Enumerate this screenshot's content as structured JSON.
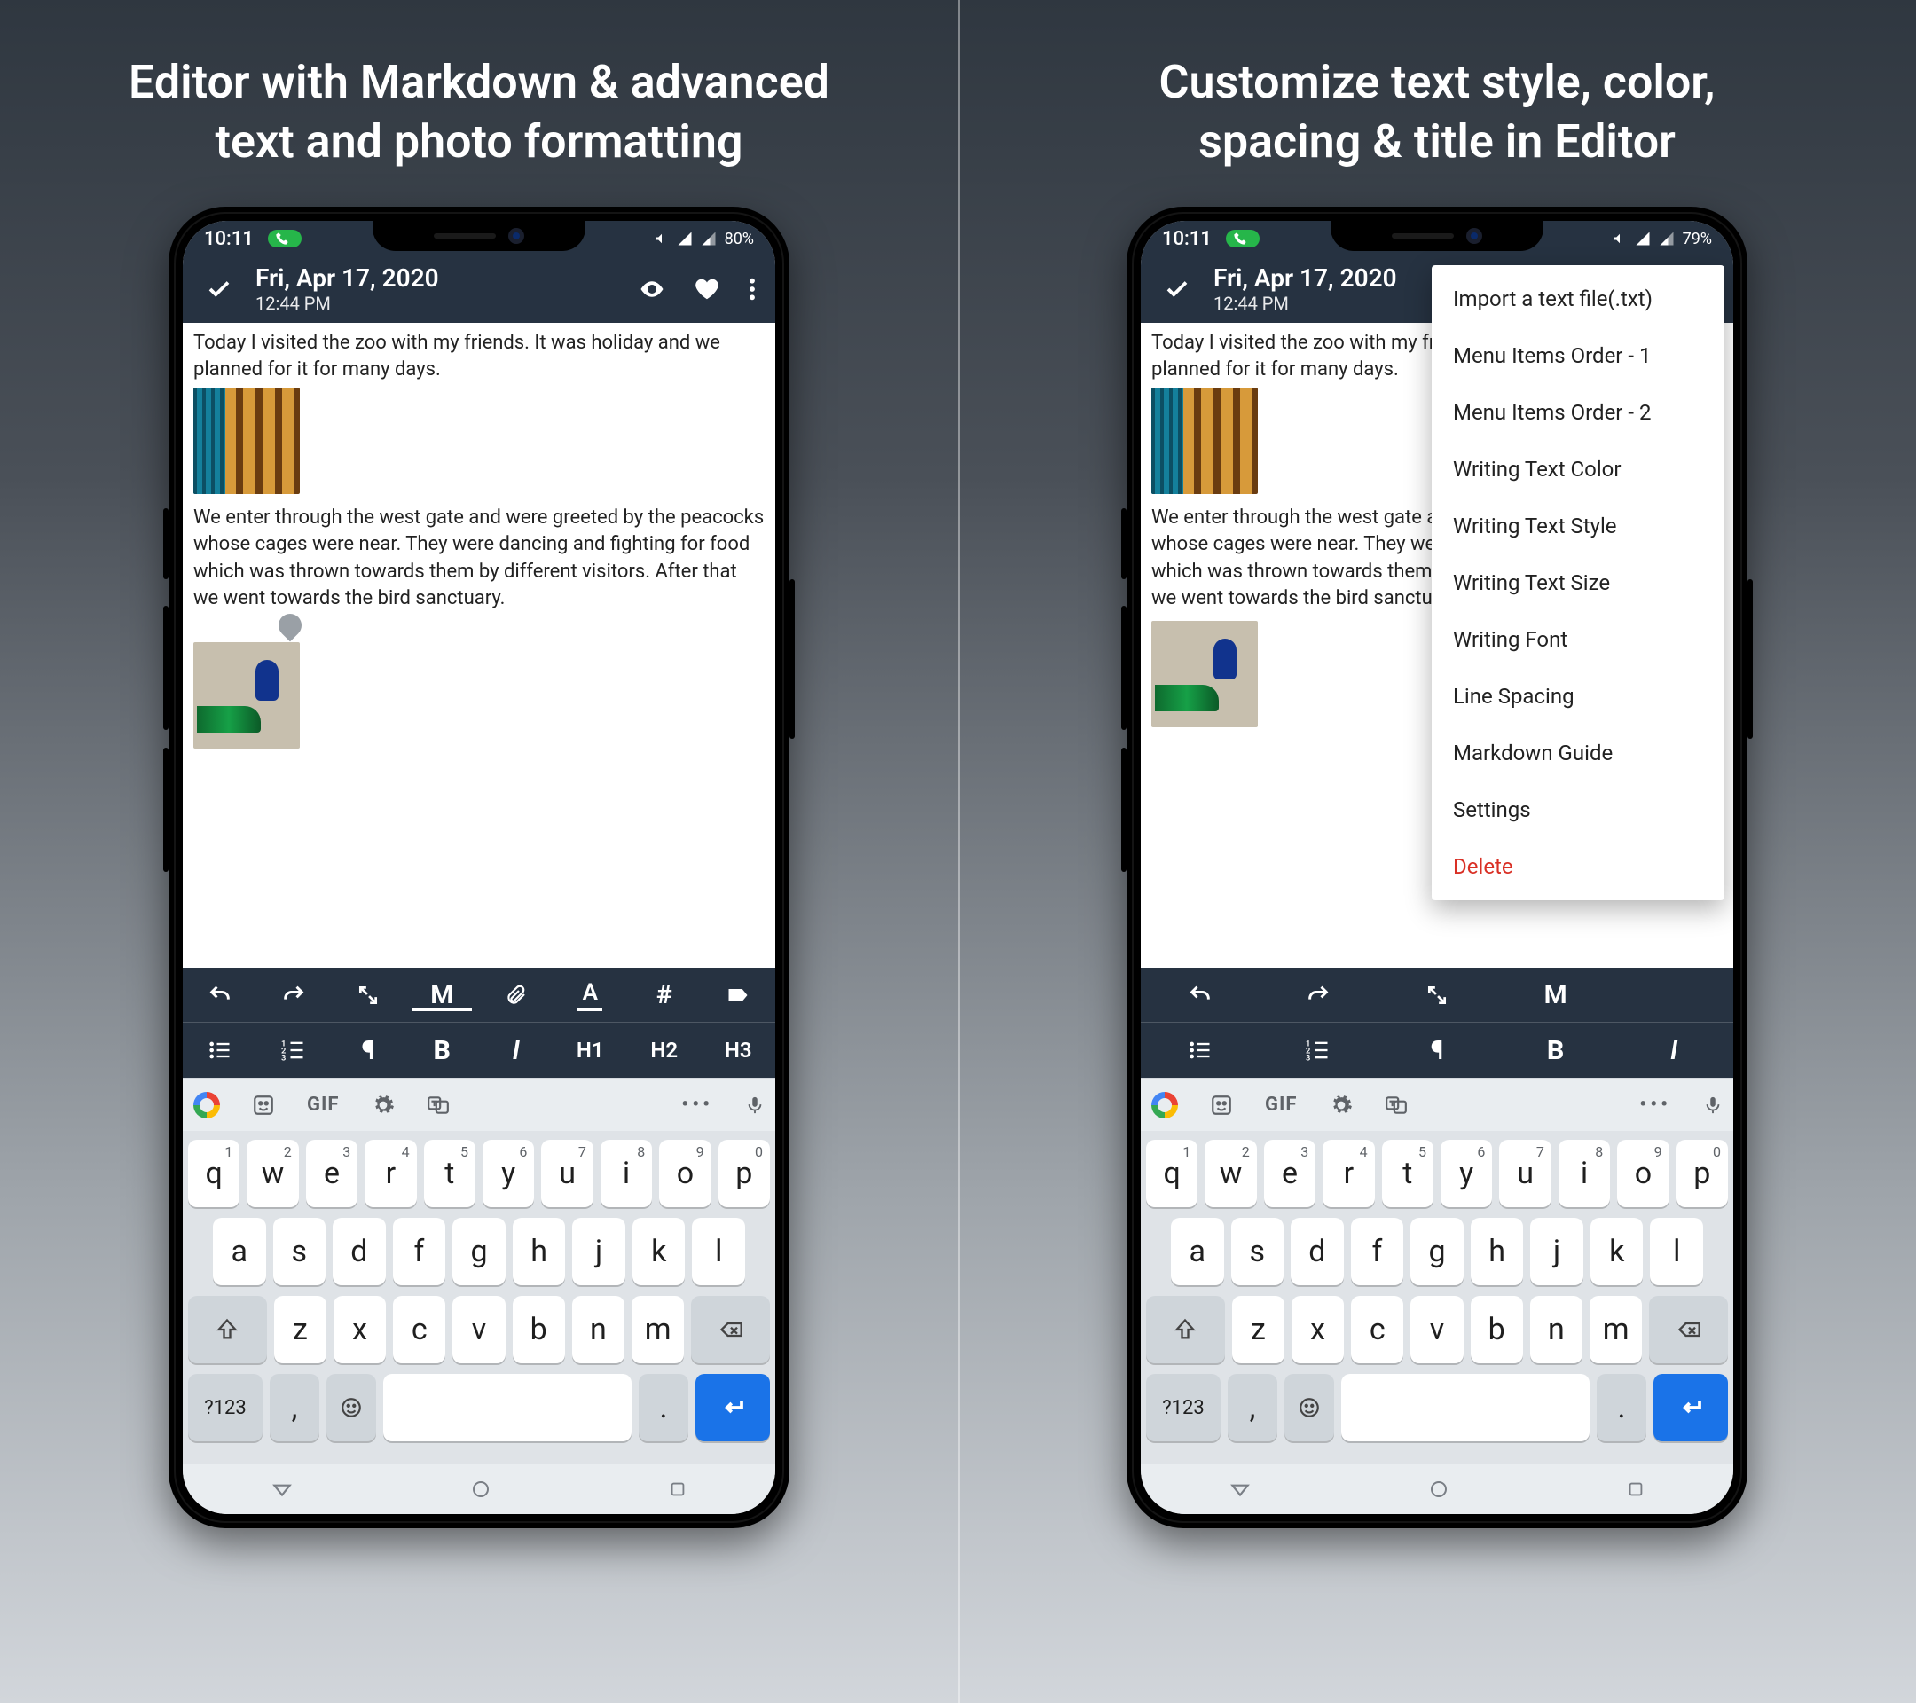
{
  "panelA": {
    "headline": "Editor with Markdown & advanced text and photo formatting",
    "status": {
      "time": "10:11",
      "battery": "80%"
    },
    "appbar": {
      "title": "Fri, Apr 17, 2020",
      "subtitle": "12:44 PM"
    },
    "content": {
      "p1": "Today I visited the zoo with my friends. It was holiday and we planned for it for many days.",
      "p2": "We enter through the west gate and were greeted by the peacocks whose cages were near. They were dancing and fighting for food which was thrown towards them by different visitors. After that we went towards the bird sanctuary."
    },
    "toolbar_top": {
      "undo": "↶",
      "redo": "↷",
      "expand": "⤢",
      "md": "M",
      "attach": "📎",
      "textcolor": "A",
      "hash": "#",
      "tag": "🏷"
    },
    "toolbar_bottom": {
      "ul": "≣",
      "ol": "≣",
      "para": "¶",
      "bold": "B",
      "italic": "I",
      "h1": "H1",
      "h2": "H2",
      "h3": "H3"
    },
    "suggest": {
      "gif": "GIF"
    },
    "keyboard": {
      "row1": [
        [
          "q",
          "1"
        ],
        [
          "w",
          "2"
        ],
        [
          "e",
          "3"
        ],
        [
          "r",
          "4"
        ],
        [
          "t",
          "5"
        ],
        [
          "y",
          "6"
        ],
        [
          "u",
          "7"
        ],
        [
          "i",
          "8"
        ],
        [
          "o",
          "9"
        ],
        [
          "p",
          "0"
        ]
      ],
      "row2": [
        "a",
        "s",
        "d",
        "f",
        "g",
        "h",
        "j",
        "k",
        "l"
      ],
      "row3": [
        "z",
        "x",
        "c",
        "v",
        "b",
        "n",
        "m"
      ],
      "sym": "?123",
      "comma": ",",
      "period": "."
    }
  },
  "panelB": {
    "headline": "Customize text style, color, spacing & title in Editor",
    "status": {
      "time": "10:11",
      "battery": "79%"
    },
    "appbar": {
      "title": "Fri, Apr 17, 2020",
      "subtitle": "12:44 PM"
    },
    "content": {
      "p1": "Today I visited the zoo with my friends. It was holiday and we planned for it for many days.",
      "p2": "We enter through the west gate and were greeted by the peacocks whose cages were near. They were dancing and fighting for food which was thrown towards them by different visitors. After that we went towards the bird sanctuary."
    },
    "menu": [
      "Import a text file(.txt)",
      "Menu Items Order - 1",
      "Menu Items Order - 2",
      "Writing Text Color",
      "Writing Text Style",
      "Writing Text Size",
      "Writing Font",
      "Line Spacing",
      "Markdown Guide",
      "Settings",
      "Delete"
    ],
    "toolbar_top": {
      "undo": "↶",
      "redo": "↷",
      "expand": "⤢",
      "md": "M"
    },
    "toolbar_bottom": {
      "ul": "≣",
      "ol": "≣",
      "para": "¶",
      "bold": "B",
      "italic": "I"
    },
    "suggest": {
      "gif": "GIF"
    },
    "keyboard": {
      "row1": [
        [
          "q",
          "1"
        ],
        [
          "w",
          "2"
        ],
        [
          "e",
          "3"
        ],
        [
          "r",
          "4"
        ],
        [
          "t",
          "5"
        ],
        [
          "y",
          "6"
        ],
        [
          "u",
          "7"
        ],
        [
          "i",
          "8"
        ],
        [
          "o",
          "9"
        ],
        [
          "p",
          "0"
        ]
      ],
      "row2": [
        "a",
        "s",
        "d",
        "f",
        "g",
        "h",
        "j",
        "k",
        "l"
      ],
      "row3": [
        "z",
        "x",
        "c",
        "v",
        "b",
        "n",
        "m"
      ],
      "sym": "?123",
      "comma": ",",
      "period": "."
    }
  }
}
